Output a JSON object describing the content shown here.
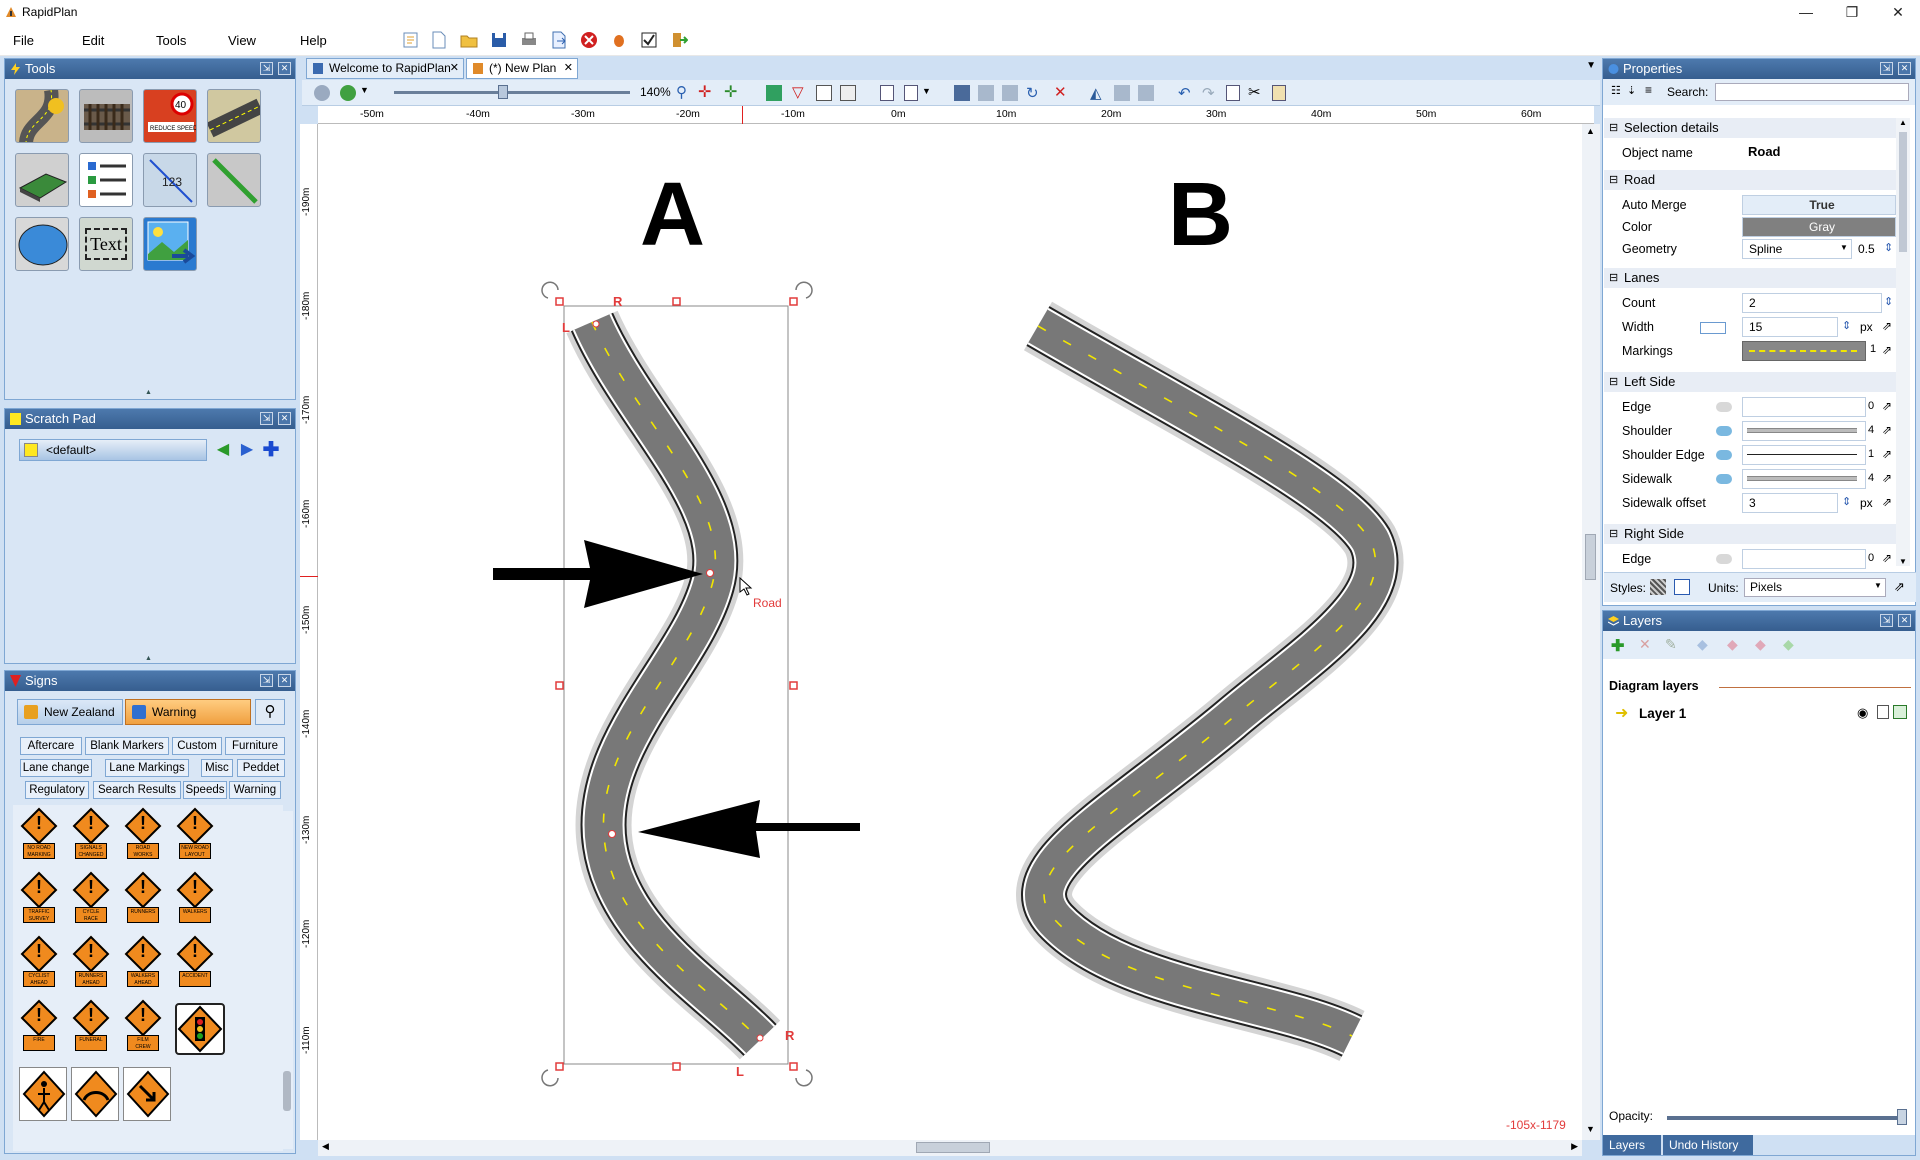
{
  "app": {
    "title": "RapidPlan",
    "window_buttons": [
      "—",
      "❐",
      "✕"
    ]
  },
  "menu": [
    "File",
    "Edit",
    "Tools",
    "View",
    "Help"
  ],
  "tools_panel": {
    "title": "Tools",
    "text_tool": "Text"
  },
  "scratch": {
    "title": "Scratch Pad",
    "selected": "<default>"
  },
  "signs": {
    "title": "Signs",
    "region_tab": "New Zealand",
    "category_tab": "Warning",
    "chips": [
      "Aftercare",
      "Blank Markers",
      "Custom",
      "Furniture",
      "Lane change",
      "Lane Markings",
      "Misc",
      "Peddet",
      "Regulatory",
      "Search Results",
      "Speeds",
      "Warning"
    ],
    "sign_labels": [
      "NO ROAD MARKING",
      "SIGNALS CHANGED",
      "ROAD WORKS",
      "NEW ROAD LAYOUT",
      "TRAFFIC SURVEY",
      "CYCLE RACE",
      "RUNNERS",
      "WALKERS",
      "CYCLIST AHEAD",
      "RUNNERS AHEAD",
      "WALKERS AHEAD",
      "ACCIDENT",
      "FIRE",
      "FUNERAL",
      "FILM CREW"
    ]
  },
  "doc_tabs": [
    "Welcome to RapidPlan",
    "(*) New Plan"
  ],
  "zoom": "140%",
  "ruler": {
    "top": [
      "-50m",
      "-40m",
      "-30m",
      "-20m",
      "-10m",
      "0m",
      "10m",
      "20m",
      "30m",
      "40m",
      "50m",
      "60m"
    ],
    "left": [
      "-190m",
      "-180m",
      "-170m",
      "-160m",
      "-150m",
      "-140m",
      "-130m",
      "-120m",
      "-110m"
    ]
  },
  "canvas": {
    "label_a": "A",
    "label_b": "B",
    "road_label": "Road",
    "marker_r": "R",
    "marker_l": "L",
    "coords": "-105x-1179"
  },
  "properties": {
    "title": "Properties",
    "search_label": "Search:",
    "sections": {
      "selection": "Selection details",
      "road": "Road",
      "lanes": "Lanes",
      "left_side": "Left Side",
      "right_side": "Right Side"
    },
    "object_name": {
      "key": "Object name",
      "value": "Road"
    },
    "auto_merge": {
      "key": "Auto Merge",
      "value": "True"
    },
    "color": {
      "key": "Color",
      "value": "Gray"
    },
    "geometry": {
      "key": "Geometry",
      "value": "Spline",
      "tension": "0.5"
    },
    "count": {
      "key": "Count",
      "value": "2"
    },
    "width": {
      "key": "Width",
      "value": "15",
      "unit": "px"
    },
    "markings": {
      "key": "Markings",
      "value": "1"
    },
    "edge": {
      "key": "Edge",
      "value": "0"
    },
    "shoulder": {
      "key": "Shoulder",
      "value": "4"
    },
    "shoulder_edge": {
      "key": "Shoulder Edge",
      "value": "1"
    },
    "sidewalk": {
      "key": "Sidewalk",
      "value": "4"
    },
    "sidewalk_offset": {
      "key": "Sidewalk offset",
      "value": "3",
      "unit": "px"
    },
    "right_edge": {
      "key": "Edge",
      "value": "0"
    },
    "styles_label": "Styles:",
    "units_label": "Units:",
    "units_value": "Pixels"
  },
  "layers": {
    "title": "Layers",
    "diagram_layers": "Diagram layers",
    "layer_name": "Layer 1",
    "opacity_label": "Opacity:",
    "bottom_tabs": [
      "Layers",
      "Undo History"
    ]
  },
  "colors": {
    "panel_head": "#3f6a9e",
    "road": "#787878",
    "lane_marking": "#f2e600",
    "handle": "#e23b3b"
  }
}
